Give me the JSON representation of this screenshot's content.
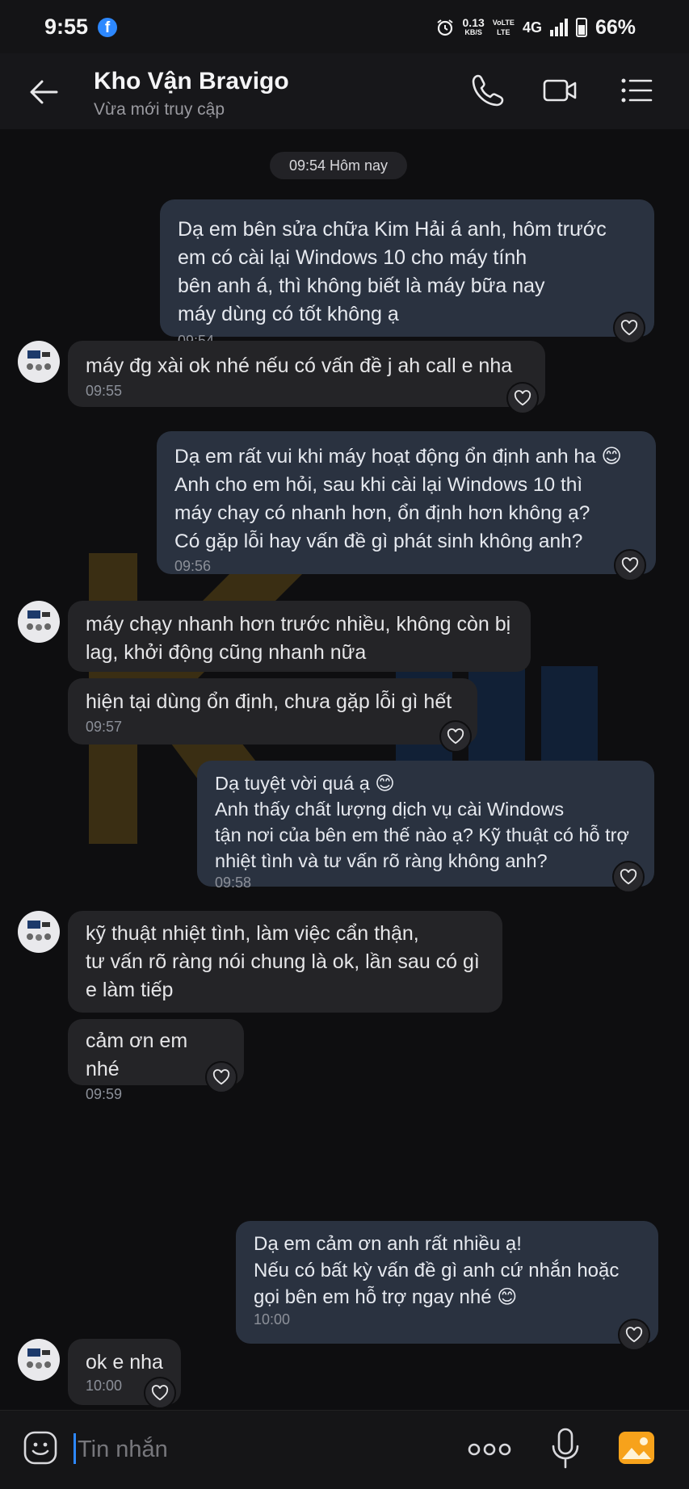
{
  "status_bar": {
    "time": "9:55",
    "net_speed_value": "0.13",
    "net_speed_unit": "KB/S",
    "volte_top": "VoLTE",
    "volte_bottom": "LTE",
    "network": "4G",
    "battery": "66%"
  },
  "header": {
    "title": "Kho Vận Bravigo",
    "subtitle": "Vừa mới truy cập"
  },
  "chat": {
    "date_label": "09:54 Hôm nay",
    "messages": [
      {
        "direction": "out",
        "text": "Dạ em bên sửa chữa Kim Hải á anh, hôm trước\nem có cài lại Windows 10 cho máy tính\nbên anh á, thì không biết là máy bữa nay\nmáy dùng có tốt không ạ",
        "time": "09:54"
      },
      {
        "direction": "in",
        "text": "máy đg xài ok nhé nếu có vấn đề j ah call e nha",
        "time": "09:55"
      },
      {
        "direction": "out",
        "text": "Dạ em rất vui khi máy hoạt động ổn định anh ha 😊\nAnh cho em hỏi, sau khi cài lại Windows 10 thì\nmáy chạy có nhanh hơn, ổn định hơn không ạ?\nCó gặp lỗi hay vấn đề gì phát sinh không anh?",
        "time": "09:56"
      },
      {
        "direction": "in",
        "text": "máy chạy nhanh hơn trước nhiều, không còn bị\nlag, khởi động cũng nhanh nữa",
        "time": ""
      },
      {
        "direction": "in",
        "text": "hiện tại dùng ổn định, chưa gặp lỗi gì hết",
        "time": "09:57"
      },
      {
        "direction": "out",
        "text": "Dạ tuyệt vời quá ạ 😊\nAnh thấy chất lượng dịch vụ cài Windows\ntận nơi của bên em thế nào ạ? Kỹ thuật có hỗ trợ\nnhiệt tình và tư vấn rõ ràng không anh?",
        "time": "09:58"
      },
      {
        "direction": "in",
        "text": "kỹ thuật nhiệt tình, làm việc cẩn thận,\ntư vấn rõ ràng nói chung là ok, lần sau có gì\ne làm tiếp",
        "time": ""
      },
      {
        "direction": "in",
        "text": "cảm ơn em nhé",
        "time": "09:59"
      },
      {
        "direction": "out",
        "text": "Dạ em cảm ơn anh rất nhiều ạ!\nNếu có bất kỳ vấn đề gì anh cứ nhắn hoặc\ngọi bên em hỗ trợ ngay nhé 😊",
        "time": "10:00"
      },
      {
        "direction": "in",
        "text": "ok e nha",
        "time": "10:00"
      }
    ]
  },
  "input_bar": {
    "placeholder": "Tin nhắn"
  },
  "icons": {
    "back": "back-arrow-icon",
    "call": "phone-icon",
    "video": "video-camera-icon",
    "menu": "list-menu-icon",
    "emoji": "sticker-icon",
    "more": "more-dots-icon",
    "mic": "microphone-icon",
    "image": "image-gallery-icon",
    "reaction": "heart-icon"
  },
  "colors": {
    "outgoing_bubble": "#2a3240",
    "incoming_bubble": "#242427",
    "accent": "#2d88ff",
    "gallery_icon": "#f7a21b"
  }
}
